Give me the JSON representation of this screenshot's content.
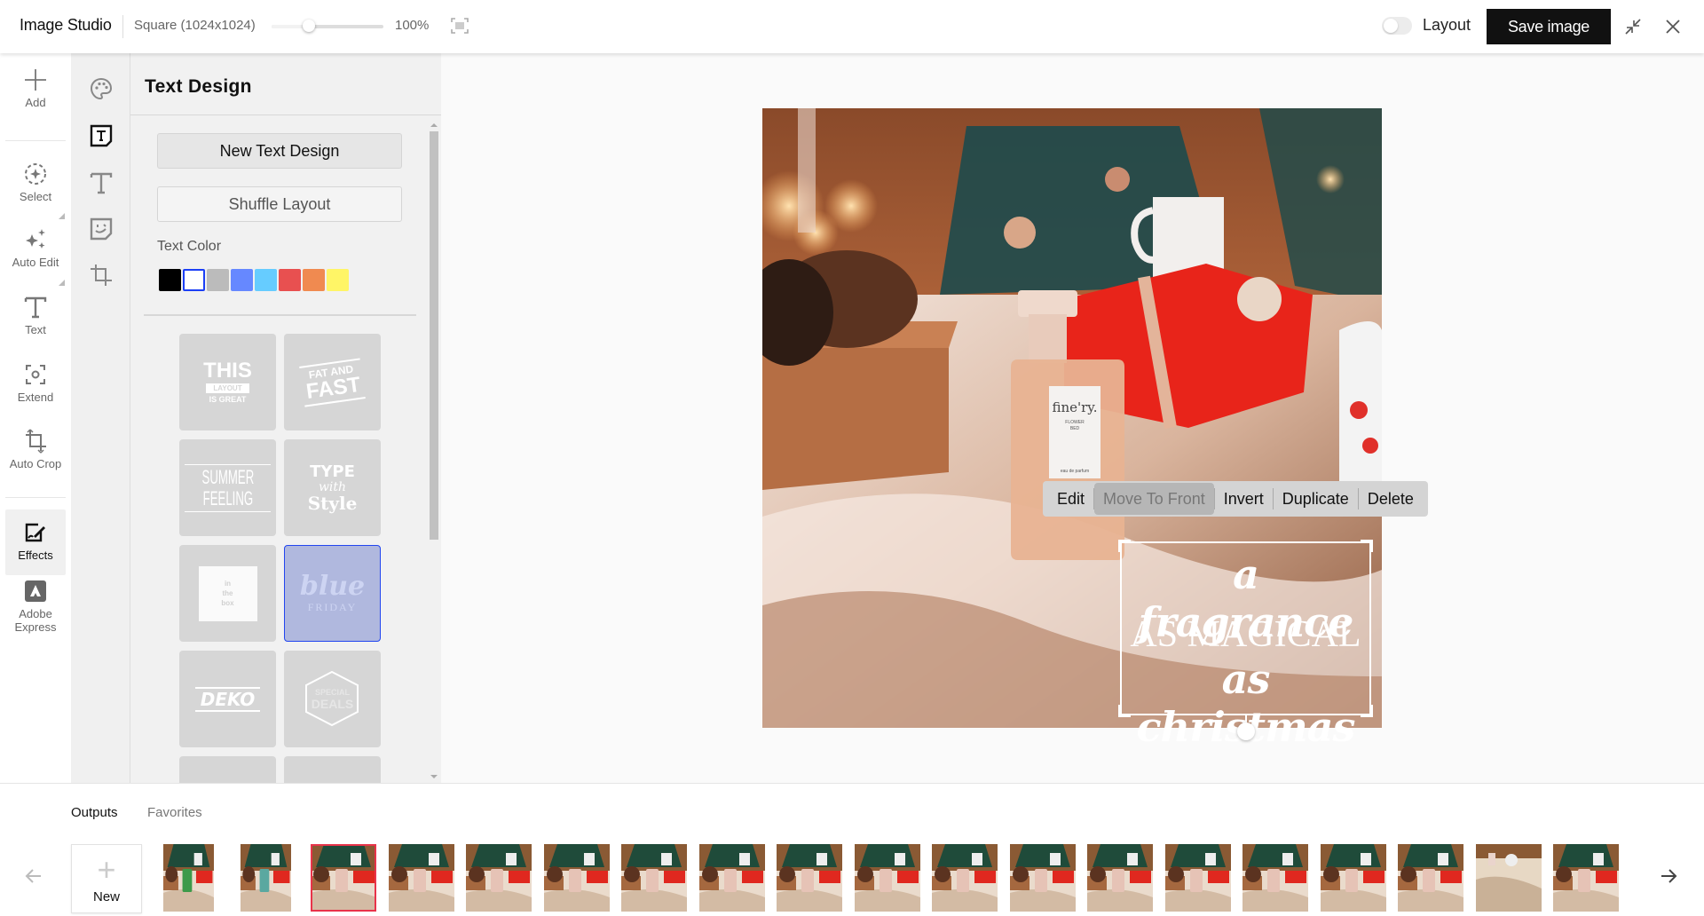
{
  "header": {
    "app_title": "Image Studio",
    "canvas_size": "Square (1024x1024)",
    "zoom_percent": "100%",
    "zoom_slider_fraction": 0.33,
    "fit_icon": "fit-screen-icon",
    "layout_toggle": {
      "label": "Layout",
      "on": false
    },
    "save_label": "Save image",
    "collapse_icon": "collapse-icon",
    "close_icon": "close-icon"
  },
  "rail": {
    "items": [
      {
        "label": "Add",
        "icon": "plus-icon"
      },
      {
        "label": "Select",
        "icon": "select-icon"
      },
      {
        "label": "Auto Edit",
        "icon": "sparkles-icon"
      },
      {
        "label": "Text",
        "icon": "text-icon"
      },
      {
        "label": "Extend",
        "icon": "extend-icon"
      },
      {
        "label": "Auto Crop",
        "icon": "crop-icon"
      },
      {
        "label": "Effects",
        "icon": "effects-icon",
        "active": true
      },
      {
        "label": "Adobe Express",
        "label_line1": "Adobe",
        "label_line2": "Express",
        "icon": "adobe-express-icon"
      }
    ]
  },
  "icon_column": {
    "items": [
      "palette-icon",
      "text-design-icon",
      "text-icon",
      "sticker-icon",
      "crop-icon"
    ],
    "active": "text-design-icon"
  },
  "panel": {
    "title": "Text Design",
    "new_button": "New Text Design",
    "shuffle_button": "Shuffle Layout",
    "text_color_label": "Text Color",
    "colors": [
      "#000000",
      "#ffffff",
      "#bbbbbb",
      "#6688ff",
      "#66ccff",
      "#e85050",
      "#f08a50",
      "#fff566"
    ],
    "selected_color": "#ffffff",
    "designs": [
      {
        "name": "this-layout-is-great",
        "lines": [
          "THIS",
          "LAYOUT",
          "IS GREAT"
        ]
      },
      {
        "name": "fat-and-fast",
        "lines": [
          "FAT AND",
          "FAST"
        ]
      },
      {
        "name": "summer-feeling",
        "lines": [
          "SUMMER",
          "FEELING"
        ]
      },
      {
        "name": "type-with-style",
        "lines": [
          "TYPE",
          "with",
          "Style"
        ]
      },
      {
        "name": "in-the-box",
        "lines": [
          "in",
          "the",
          "box"
        ]
      },
      {
        "name": "blue-friday",
        "lines": [
          "blue",
          "FRIDAY"
        ],
        "selected": true
      },
      {
        "name": "deko",
        "lines": [
          "DEKO"
        ]
      },
      {
        "name": "special-deals",
        "lines": [
          "SPECIAL",
          "DEALS"
        ]
      }
    ]
  },
  "canvas": {
    "image_description": "Perfume bottle on fur rug with pine cones, gift boxes, mug and Christmas tree",
    "bottle_label": {
      "brand": "fine'ry.",
      "name_line1": "FLOWER",
      "name_line2": "BED",
      "type": "eau de parfum"
    },
    "context_menu": [
      "Edit",
      "Move To Front",
      "Invert",
      "Duplicate",
      "Delete"
    ],
    "context_menu_disabled": "Move To Front",
    "text_overlay": {
      "line1": "a fragrance",
      "line2": "AS MAGICAL",
      "line3": "as christmas"
    }
  },
  "bottom": {
    "tabs": [
      "Outputs",
      "Favorites"
    ],
    "active_tab": "Outputs",
    "new_label": "New",
    "thumbnail_count": 19,
    "selected_thumbnail_index": 2,
    "prev_icon": "arrow-left-icon",
    "next_icon": "arrow-right-icon"
  }
}
